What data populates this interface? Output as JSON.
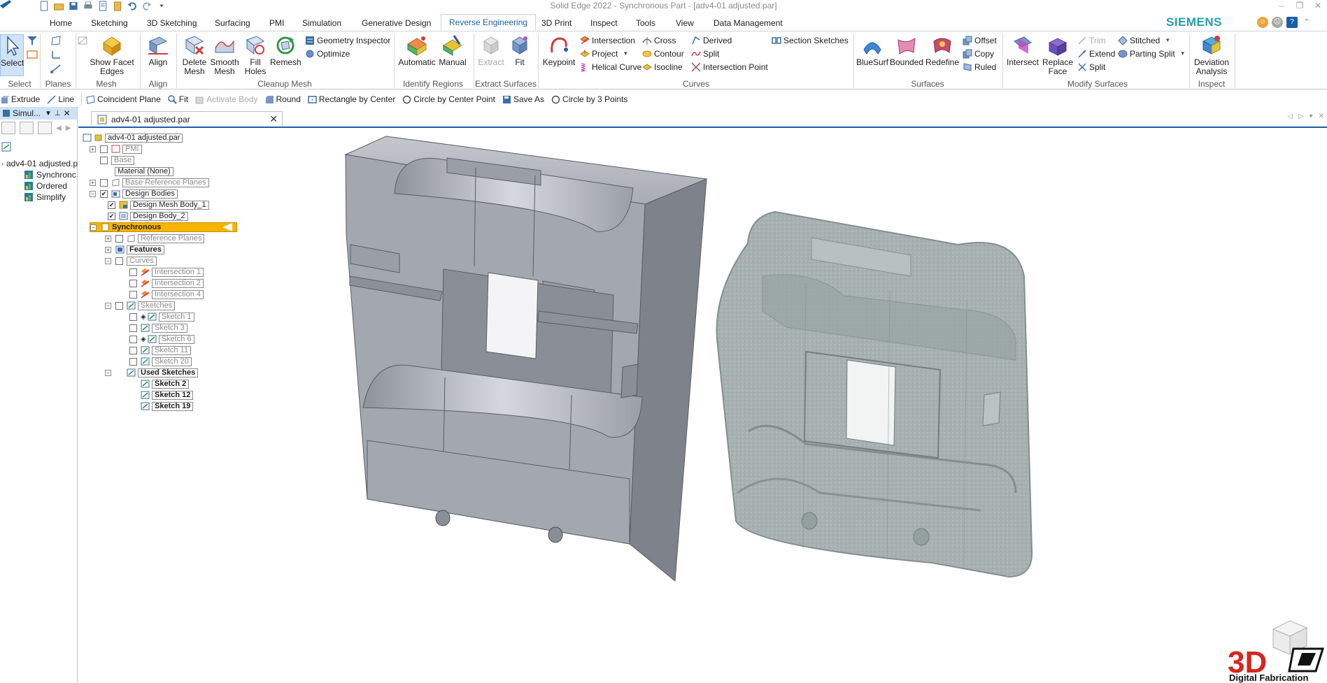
{
  "window": {
    "title": "Solid Edge 2022 - Synchronous Part - [adv4-01 adjusted.par]",
    "controls": [
      "–",
      "❐",
      "✕"
    ]
  },
  "brand": "SIEMENS",
  "menu_tabs": [
    "Home",
    "Sketching",
    "3D Sketching",
    "Surfacing",
    "PMI",
    "Simulation",
    "Generative Design",
    "Reverse Engineering",
    "3D Print",
    "Inspect",
    "Tools",
    "View",
    "Data Management"
  ],
  "active_tab": "Reverse Engineering",
  "ribbon": {
    "select": {
      "label": "Select",
      "group": "Select"
    },
    "planes_group": "Planes",
    "mesh": {
      "show_facet_edges": "Show Facet Edges",
      "group": "Mesh"
    },
    "align": {
      "label": "Align",
      "group": "Align"
    },
    "cleanup": {
      "delete_mesh": "Delete Mesh",
      "smooth_mesh": "Smooth Mesh",
      "fill_holes": "Fill Holes",
      "remesh": "Remesh",
      "geometry_inspector": "Geometry Inspector",
      "optimize": "Optimize",
      "group": "Cleanup Mesh"
    },
    "identify": {
      "automatic": "Automatic",
      "manual": "Manual",
      "group": "Identify Regions"
    },
    "extract": {
      "extract": "Extract",
      "fit": "Fit",
      "group": "Extract Surfaces"
    },
    "curves": {
      "keypoint": "Keypoint",
      "intersection": "Intersection",
      "project": "Project",
      "helical_curve": "Helical Curve",
      "cross": "Cross",
      "contour": "Contour",
      "isocline": "Isocline",
      "derived": "Derived",
      "split": "Split",
      "intersection_point": "Intersection Point",
      "section_sketches": "Section Sketches",
      "group": "Curves"
    },
    "surfaces": {
      "bluesurf": "BlueSurf",
      "bounded": "Bounded",
      "redefine": "Redefine",
      "offset": "Offset",
      "copy": "Copy",
      "ruled": "Ruled",
      "group": "Surfaces"
    },
    "modify": {
      "intersect": "Intersect",
      "replace_face": "Replace Face",
      "trim": "Trim",
      "extend": "Extend",
      "split": "Split",
      "stitched": "Stitched",
      "parting_split": "Parting Split",
      "group": "Modify Surfaces"
    },
    "inspect": {
      "deviation_analysis": "Deviation Analysis",
      "group": "Inspect"
    }
  },
  "command_bar": [
    "Extrude",
    "Line",
    "Coincident Plane",
    "Fit",
    "Activate Body",
    "Round",
    "Rectangle by Center",
    "Circle by Center Point",
    "Save As",
    "Circle by 3 Points"
  ],
  "left_pane": {
    "header": "Simul...",
    "items": [
      "adv4-01 adjusted.p",
      "Synchronc",
      "Ordered",
      "Simplify"
    ]
  },
  "doc_tab": {
    "label": "adv4-01 adjusted.par"
  },
  "tree": {
    "root": "adv4-01 adjusted.par",
    "pmi": "PMI",
    "base": "Base",
    "material": "Material (None)",
    "base_ref_planes": "Base Reference Planes",
    "design_bodies": "Design Bodies",
    "mesh_body": "Design Mesh Body_1",
    "body2": "Design Body_2",
    "synchronous": "Synchronous",
    "ref_planes": "Reference Planes",
    "features": "Features",
    "curves": "Curves",
    "intersections": [
      "Intersection 1",
      "Intersection 2",
      "Intersection 4"
    ],
    "sketches": "Sketches",
    "sketch_items": [
      "Sketch 1",
      "Sketch 3",
      "Sketch 6",
      "Sketch 11",
      "Sketch 20"
    ],
    "used_sketches": "Used Sketches",
    "used_items": [
      "Sketch 2",
      "Sketch 12",
      "Sketch 19"
    ]
  },
  "watermark": {
    "logo": "3D",
    "caption": "Digital Fabrication"
  },
  "colors": {
    "accent": "#1a5fa8",
    "brand": "#23a0aa",
    "selection": "#f7b500",
    "model": "#a9acb3",
    "mesh": "#9aa6a6"
  }
}
